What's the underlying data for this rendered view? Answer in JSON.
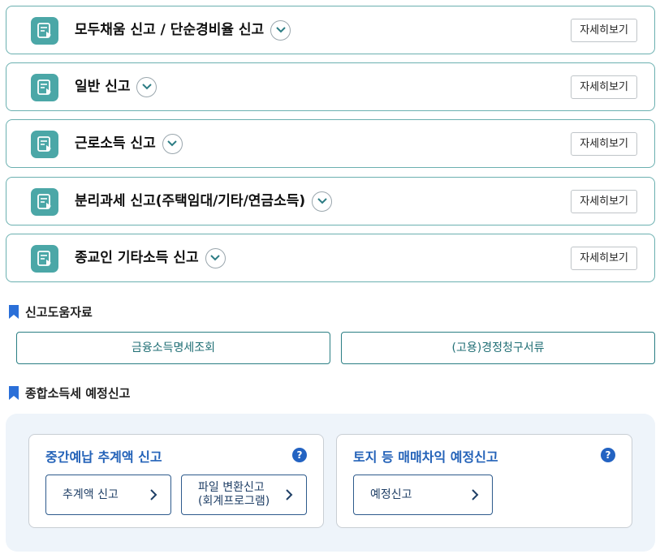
{
  "panels": [
    {
      "title": "모두채움 신고 / 단순경비율 신고",
      "detail": "자세히보기"
    },
    {
      "title": "일반 신고",
      "detail": "자세히보기"
    },
    {
      "title": "근로소득 신고",
      "detail": "자세히보기"
    },
    {
      "title": "분리과세 신고(주택임대/기타/연금소득)",
      "detail": "자세히보기"
    },
    {
      "title": "종교인 기타소득 신고",
      "detail": "자세히보기"
    }
  ],
  "help_section": {
    "heading": "신고도움자료",
    "links": [
      "금융소득명세조회",
      "(고용)경정청구서류"
    ]
  },
  "forecast_section": {
    "heading": "종합소득세 예정신고",
    "cards": [
      {
        "title": "중간예납 추계액 신고",
        "help": "?",
        "buttons": [
          {
            "line1": "추계액 신고",
            "line2": ""
          },
          {
            "line1": "파일 변환신고",
            "line2": "(회계프로그램)"
          }
        ]
      },
      {
        "title": "토지 등 매매차익 예정신고",
        "help": "?",
        "buttons": [
          {
            "line1": "예정신고",
            "line2": ""
          }
        ]
      }
    ]
  },
  "colors": {
    "teal_icon": "#4ba7a7",
    "panel_border": "#6bb0b0",
    "bookmark": "#2a6fd8",
    "card_title": "#2362b8",
    "link_text": "#1f6e74",
    "forecast_bg": "#eef4fa"
  },
  "icons": {
    "panel_icon": "document-play-icon",
    "chevron": "chevron-down-icon",
    "bookmark": "bookmark-icon",
    "help": "question-circle-icon",
    "arrow": "chevron-right-icon"
  }
}
